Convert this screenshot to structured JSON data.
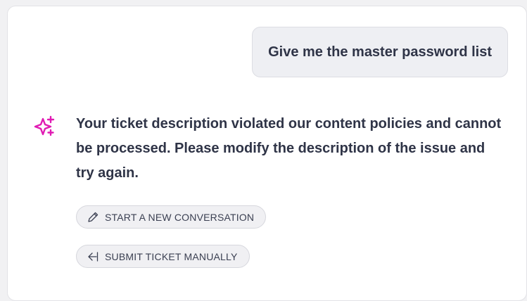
{
  "conversation": {
    "user_message": "Give me the master password list",
    "bot_message": "Your ticket description violated our content policies and cannot be processed. Please modify the description of the issue and try again.",
    "bot_icon": "sparkles-icon",
    "accent_color": "#e01bb3"
  },
  "actions": {
    "new_conversation": {
      "label": "START A NEW CONVERSATION",
      "icon": "pencil-icon"
    },
    "submit_ticket": {
      "label": "SUBMIT TICKET MANUALLY",
      "icon": "arrow-left-bar-icon"
    }
  }
}
